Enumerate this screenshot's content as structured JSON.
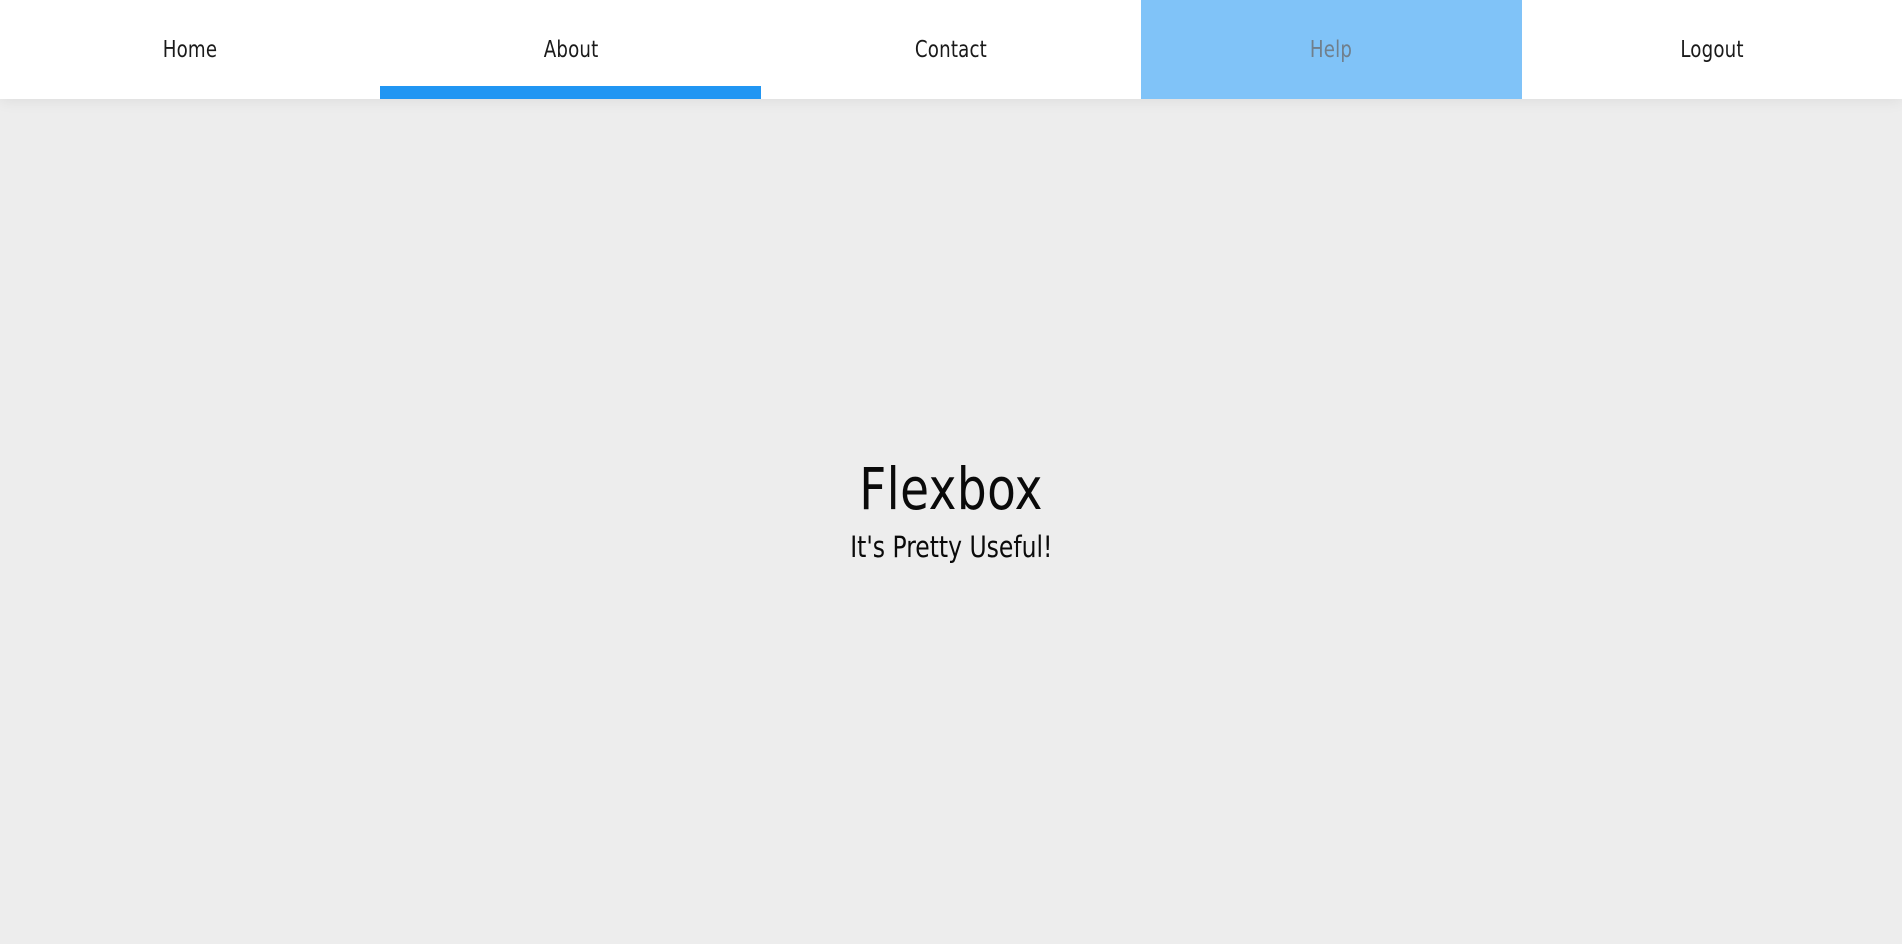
{
  "nav": {
    "items": [
      {
        "label": "Home",
        "state": "default"
      },
      {
        "label": "About",
        "state": "active"
      },
      {
        "label": "Contact",
        "state": "default"
      },
      {
        "label": "Help",
        "state": "hovered"
      },
      {
        "label": "Logout",
        "state": "default"
      }
    ]
  },
  "hero": {
    "title": "Flexbox",
    "subtitle": "It's Pretty Useful!"
  },
  "colors": {
    "accent": "#2196f3",
    "hover_bg": "#80c3f8",
    "page_bg": "#ededed",
    "nav_bg": "#ffffff"
  }
}
